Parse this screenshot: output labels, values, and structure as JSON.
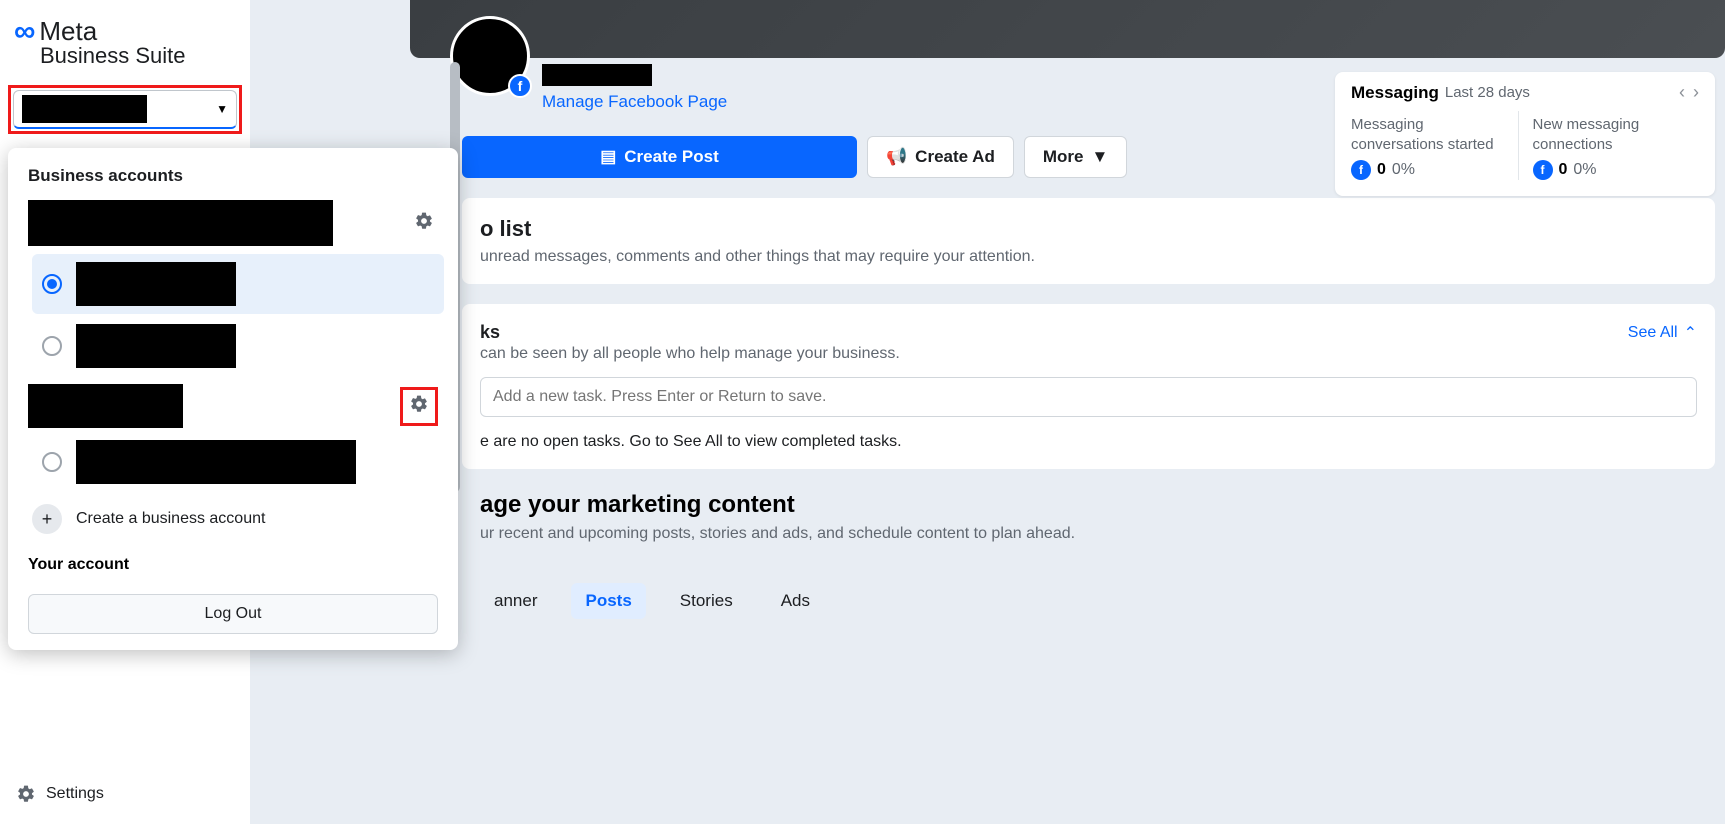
{
  "brand": {
    "name": "Meta",
    "suite": "Business Suite"
  },
  "sidebar": {
    "settings_label": "Settings"
  },
  "popover": {
    "header": "Business accounts",
    "create_label": "Create a business account",
    "your_account_label": "Your account",
    "logout_label": "Log Out"
  },
  "pageHeader": {
    "manage_link": "Manage Facebook Page"
  },
  "actions": {
    "create_post": "Create Post",
    "create_ad": "Create Ad",
    "more": "More"
  },
  "todo": {
    "title_fragment": "o list",
    "subtitle_fragment": "unread messages, comments and other things that may require your attention."
  },
  "tasks": {
    "title_fragment": "ks",
    "see_all": "See All",
    "desc_fragment": " can be seen by all people who help manage your business.",
    "input_placeholder": "Add a new task. Press Enter or Return to save.",
    "empty_fragment": "e are no open tasks. Go to See All to view completed tasks."
  },
  "marketing": {
    "title_fragment": "age your marketing content",
    "subtitle_fragment": "ur recent and upcoming posts, stories and ads, and schedule content to plan ahead.",
    "tabs": {
      "planner_fragment": "anner",
      "posts": "Posts",
      "stories": "Stories",
      "ads": "Ads"
    }
  },
  "insights": {
    "title": "Messaging",
    "period": "Last 28 days",
    "metric1": {
      "label": "Messaging conversations started",
      "value": "0",
      "pct": "0%"
    },
    "metric2": {
      "label": "New messaging connections",
      "value": "0",
      "pct": "0%"
    }
  }
}
